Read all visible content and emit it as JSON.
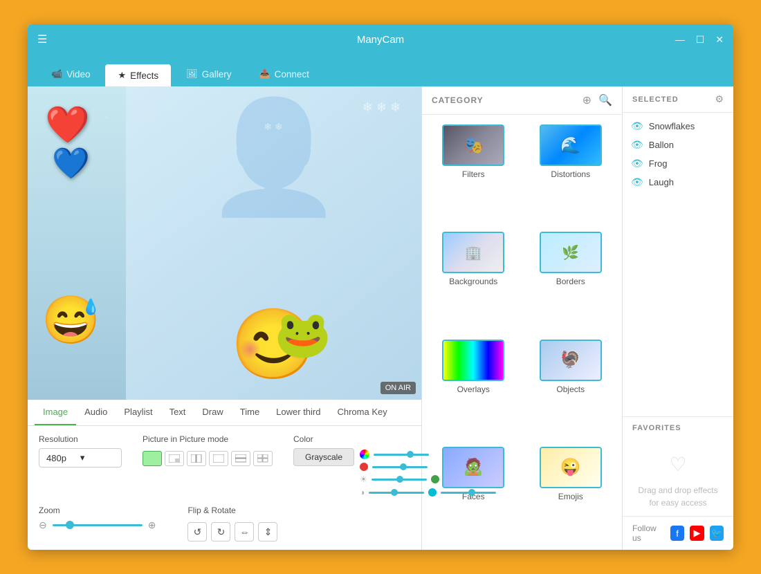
{
  "app": {
    "title": "ManyCam",
    "window_controls": {
      "minimize": "—",
      "maximize": "☐",
      "close": "✕"
    }
  },
  "nav": {
    "tabs": [
      {
        "id": "video",
        "label": "Video",
        "icon": "📹",
        "active": false
      },
      {
        "id": "effects",
        "label": "Effects",
        "icon": "★",
        "active": true
      },
      {
        "id": "gallery",
        "label": "Gallery",
        "icon": "🖼",
        "active": false
      },
      {
        "id": "connect",
        "label": "Connect",
        "icon": "📤",
        "active": false
      }
    ]
  },
  "preview": {
    "on_air_label": "ON AIR"
  },
  "sub_tabs": [
    {
      "id": "image",
      "label": "Image",
      "active": true
    },
    {
      "id": "audio",
      "label": "Audio",
      "active": false
    },
    {
      "id": "playlist",
      "label": "Playlist",
      "active": false
    },
    {
      "id": "text",
      "label": "Text",
      "active": false
    },
    {
      "id": "draw",
      "label": "Draw",
      "active": false
    },
    {
      "id": "time",
      "label": "Time",
      "active": false
    },
    {
      "id": "lower_third",
      "label": "Lower third",
      "active": false
    },
    {
      "id": "chroma_key",
      "label": "Chroma Key",
      "active": false
    }
  ],
  "settings": {
    "resolution_label": "Resolution",
    "resolution_value": "480p",
    "zoom_label": "Zoom",
    "pip_label": "Picture in Picture mode",
    "flip_label": "Flip & Rotate",
    "color_label": "Color",
    "color_btn_label": "Grayscale"
  },
  "category": {
    "title": "CATEGORY",
    "items": [
      {
        "id": "filters",
        "label": "Filters",
        "class": "filters"
      },
      {
        "id": "distortions",
        "label": "Distortions",
        "class": "distortions"
      },
      {
        "id": "backgrounds",
        "label": "Backgrounds",
        "class": "backgrounds"
      },
      {
        "id": "borders",
        "label": "Borders",
        "class": "borders"
      },
      {
        "id": "overlays",
        "label": "Overlays",
        "class": "overlays"
      },
      {
        "id": "objects",
        "label": "Objects",
        "class": "objects"
      },
      {
        "id": "face1",
        "label": "Faces",
        "class": "face1"
      },
      {
        "id": "face2",
        "label": "Emojis",
        "class": "face2"
      }
    ]
  },
  "selected": {
    "title": "SELECTED",
    "items": [
      {
        "label": "Snowflakes"
      },
      {
        "label": "Ballon"
      },
      {
        "label": "Frog"
      },
      {
        "label": "Laugh"
      }
    ],
    "favorites_title": "FAVORITES",
    "favorites_hint": "Drag and drop effects for easy access"
  },
  "follow": {
    "label": "Follow us"
  }
}
